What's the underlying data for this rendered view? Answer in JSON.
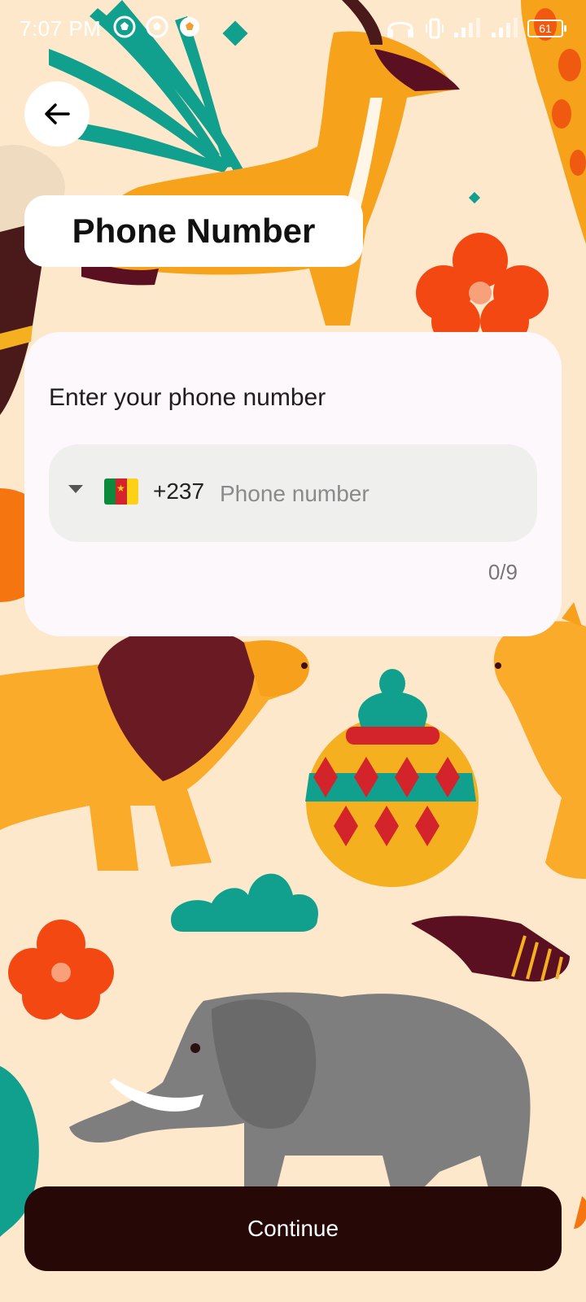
{
  "status_bar": {
    "time": "7:07 PM",
    "battery": "61",
    "left_icons": [
      "soccer-ball-icon",
      "soccer-ball-icon",
      "soccer-ball-icon",
      "diamond-icon"
    ],
    "right_icons": [
      "headset-icon",
      "vibrate-icon",
      "signal-icon",
      "signal-icon",
      "battery-icon"
    ]
  },
  "header": {
    "back_icon": "arrow-left-icon",
    "title": "Phone Number"
  },
  "form": {
    "heading": "Enter your phone number",
    "country_flag": "cameroon-flag",
    "dial_code": "+237",
    "phone_placeholder": "Phone number",
    "phone_value": "",
    "char_counter": "0/9"
  },
  "actions": {
    "continue_label": "Continue"
  },
  "colors": {
    "background": "#fde8cc",
    "card": "#fdf8fb",
    "field": "#eff0ee",
    "button": "#260806"
  }
}
